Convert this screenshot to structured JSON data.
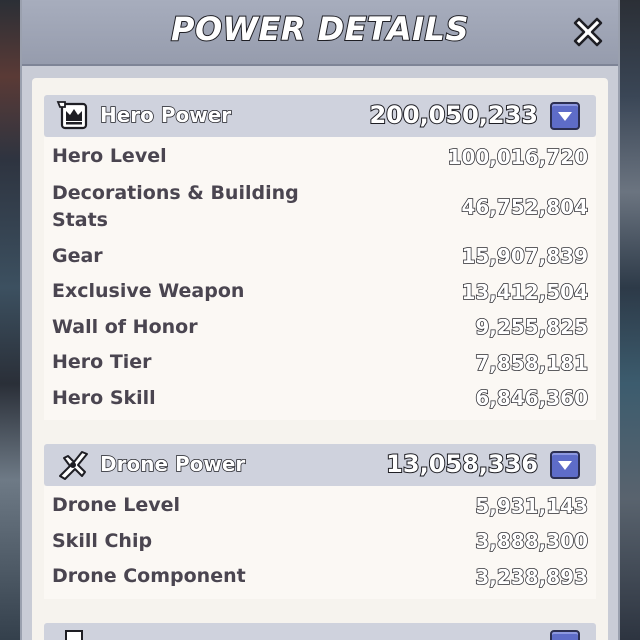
{
  "title": "POWER DETAILS",
  "sections": [
    {
      "label": "Hero Power",
      "value": "200,050,233",
      "icon": "crown-frame-icon",
      "rows": [
        {
          "label": "Hero Level",
          "value": "100,016,720"
        },
        {
          "label": "Decorations & Building Stats",
          "value": "46,752,804"
        },
        {
          "label": "Gear",
          "value": "15,907,839"
        },
        {
          "label": "Exclusive Weapon",
          "value": "13,412,504"
        },
        {
          "label": "Wall of Honor",
          "value": "9,255,825"
        },
        {
          "label": "Hero Tier",
          "value": "7,858,181"
        },
        {
          "label": "Hero Skill",
          "value": "6,846,360"
        }
      ]
    },
    {
      "label": "Drone Power",
      "value": "13,058,336",
      "icon": "drone-icon",
      "rows": [
        {
          "label": "Drone Level",
          "value": "5,931,143"
        },
        {
          "label": "Skill Chip",
          "value": "3,888,300"
        },
        {
          "label": "Drone Component",
          "value": "3,238,893"
        }
      ]
    }
  ]
}
